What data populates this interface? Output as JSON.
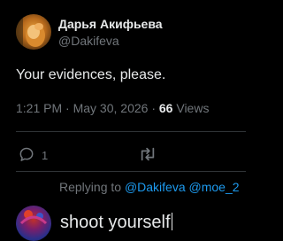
{
  "post": {
    "author_name": "Дарья Акифьева",
    "author_handle": "@Dakifeva",
    "text": "Your evidences, please.",
    "time": "1:21 PM",
    "separator": "·",
    "date": "May 30, 2026",
    "views_count": "66",
    "views_label": "Views"
  },
  "actions": {
    "reply_count": "1",
    "reply_icon": "reply-icon",
    "retweet_icon": "retweet-icon"
  },
  "reply_composer": {
    "replying_to_label": "Replying to",
    "mention_1": "@Dakifeva",
    "mention_2": "@moe_2",
    "draft_text": "shoot yourself"
  },
  "colors": {
    "background": "#000000",
    "text": "#e7e9ea",
    "muted": "#71767b",
    "accent": "#1d9bf0",
    "divider": "#2f3336"
  }
}
